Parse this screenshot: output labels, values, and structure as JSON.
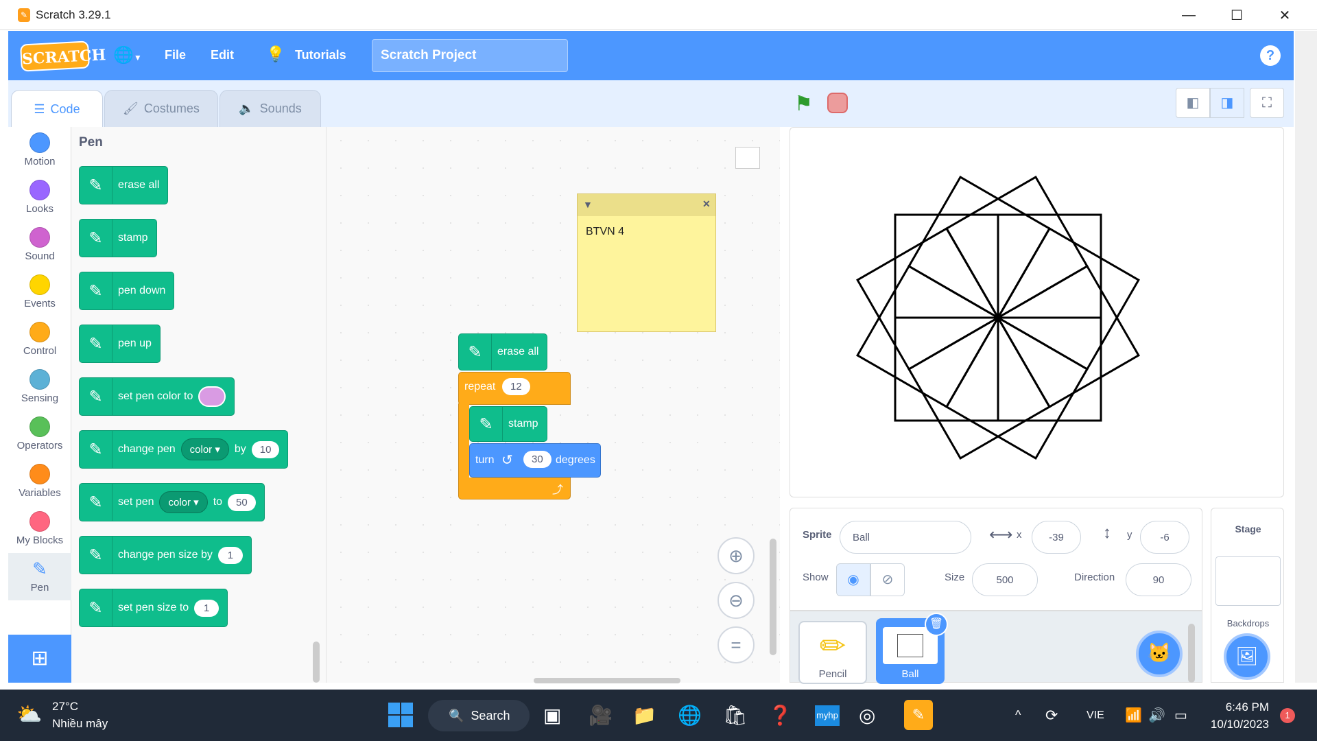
{
  "window": {
    "title": "Scratch 3.29.1"
  },
  "menu": {
    "file": "File",
    "edit": "Edit",
    "tutorials": "Tutorials",
    "project_title": "Scratch Project",
    "logo": "SCRATCH"
  },
  "tabs": [
    {
      "label": "Code"
    },
    {
      "label": "Costumes"
    },
    {
      "label": "Sounds"
    }
  ],
  "categories": [
    {
      "label": "Motion",
      "color": "#4c97ff"
    },
    {
      "label": "Looks",
      "color": "#9966ff"
    },
    {
      "label": "Sound",
      "color": "#cf63cf"
    },
    {
      "label": "Events",
      "color": "#ffd500"
    },
    {
      "label": "Control",
      "color": "#ffab19"
    },
    {
      "label": "Sensing",
      "color": "#5cb1d6"
    },
    {
      "label": "Operators",
      "color": "#59c059"
    },
    {
      "label": "Variables",
      "color": "#ff8c1a"
    },
    {
      "label": "My Blocks",
      "color": "#ff6680"
    },
    {
      "label": "Pen",
      "color": "#0fbd8c"
    }
  ],
  "palette": {
    "title": "Pen",
    "blocks": {
      "erase_all": "erase all",
      "stamp": "stamp",
      "pen_down": "pen down",
      "pen_up": "pen up",
      "set_color": "set pen color to",
      "change_pen": "change pen",
      "change_param": "color",
      "by": "by",
      "change_value": "10",
      "set_pen": "set pen",
      "set_param": "color",
      "to": "to",
      "set_value": "50",
      "change_size": "change pen size by",
      "change_size_value": "1",
      "set_size": "set pen size to",
      "set_size_value": "1"
    }
  },
  "script": {
    "erase_all": "erase all",
    "repeat": "repeat",
    "repeat_count": "12",
    "stamp": "stamp",
    "turn": "turn",
    "turn_value": "30",
    "degrees": "degrees"
  },
  "note": {
    "text": "BTVN 4"
  },
  "sprite_info": {
    "sprite_label": "Sprite",
    "sprite_name": "Ball",
    "x_label": "x",
    "x": "-39",
    "y_label": "y",
    "y": "-6",
    "show_label": "Show",
    "size_label": "Size",
    "size": "500",
    "direction_label": "Direction",
    "direction": "90"
  },
  "sprites": [
    {
      "name": "Pencil"
    },
    {
      "name": "Ball"
    }
  ],
  "stage_panel": {
    "title": "Stage",
    "backdrops": "Backdrops"
  },
  "taskbar": {
    "weather_temp": "27°C",
    "weather_desc": "Nhiều mây",
    "search": "Search",
    "lang": "VIE",
    "time": "6:46 PM",
    "date": "10/10/2023",
    "notif_count": "1"
  }
}
